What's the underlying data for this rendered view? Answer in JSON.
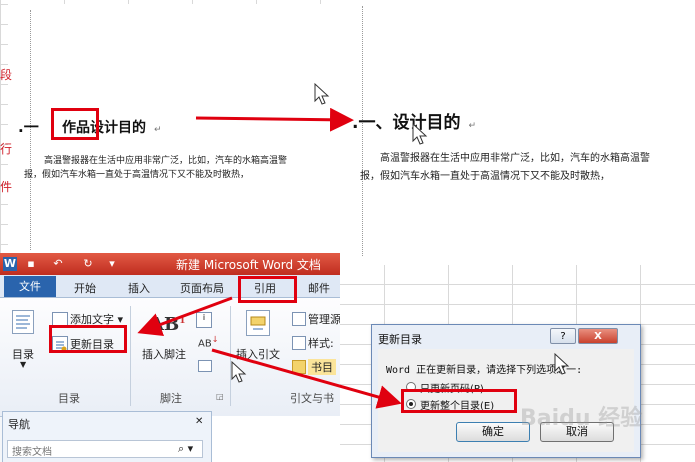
{
  "document_left": {
    "heading_number": ".一",
    "heading_text": "作品设计目的",
    "paragraph_line1": "高温警报器在生活中应用非常广泛，比如，汽车的水箱高温警",
    "paragraph_line2": "报，假如汽车水箱一直处于高温情况下又不能及时散热，"
  },
  "document_right": {
    "heading_text": ".一、设计目的",
    "paragraph_line1": "高温警报器在生活中应用非常广泛，比如，汽车的水箱高温警",
    "paragraph_line2": "报，假如汽车水箱一直处于高温情况下又不能及时散热，"
  },
  "word": {
    "title": "新建 Microsoft Word 文档",
    "quick_access": [
      "W",
      "▪",
      "↶",
      "↻",
      "▾"
    ],
    "tabs": {
      "file": "文件",
      "home": "开始",
      "insert": "插入",
      "layout": "页面布局",
      "references": "引用",
      "mailings": "邮件"
    },
    "ribbon": {
      "toc": "目录",
      "add_text": "添加文字",
      "update_toc": "更新目录",
      "toc_group": "目录",
      "insert_footnote": "插入脚注",
      "footnote_group": "脚注",
      "insert_citation": "插入引文",
      "manage_sources": "管理源",
      "style": "样式:",
      "bibliography": "书目",
      "citations_group": "引文与书"
    },
    "nav": {
      "title": "导航",
      "search_placeholder": "搜索文档"
    }
  },
  "dialog": {
    "title": "更新目录",
    "help_btn": "?",
    "close_btn": "X",
    "message": "Word 正在更新目录，请选择下列选项之一:",
    "option_page_numbers": "只更新页码(P)",
    "option_entire_table": "更新整个目录(E)",
    "selected_option": "entire",
    "ok": "确定",
    "cancel": "取消"
  },
  "watermark": "Baidu 经验",
  "colors": {
    "highlight_red": "#e0000f",
    "word_title_red": "#c83b2d",
    "file_tab_blue": "#2a64ad"
  }
}
